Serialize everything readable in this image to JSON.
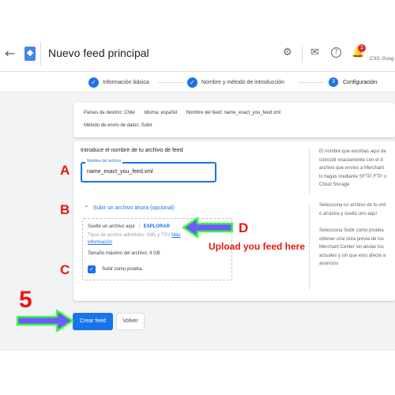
{
  "header": {
    "back_icon": "arrow-back-icon",
    "logo_icon": "merchant-center-logo-icon",
    "title": "Nuevo feed principal",
    "icons": [
      "gear-icon",
      "mail-icon",
      "help-icon",
      "bell-icon"
    ],
    "notification_count": "1",
    "account": "CSS: Goog"
  },
  "stepper": {
    "steps": [
      {
        "label": "Información básica",
        "state": "done"
      },
      {
        "label": "Nombre y método de introducción",
        "state": "done"
      },
      {
        "label": "Configuración",
        "state": "current",
        "number": "3"
      }
    ]
  },
  "summary": {
    "countries_label": "Países de destino:",
    "countries_value": "Chile",
    "language_label": "Idioma:",
    "language_value": "español",
    "file_label": "Nombre del feed:",
    "file_value": "name_exact_you_feed.xml",
    "method_label": "Método de envío de datos:",
    "method_value": "Subir"
  },
  "form": {
    "heading": "Introduce el nombre de tu archivo de feed",
    "field_label": "Nombre del archivo",
    "field_value": "name_exact_you_feed.xml",
    "help_text": [
      "El nombre que escribas aquí de",
      "coincidir exactamente con el d",
      "archivo que envíes a Merchant",
      "lo hagas mediante SFTP, FTP o",
      "Cloud Storage"
    ],
    "upload_toggle": "Subir un archivo ahora (opcional)",
    "drop_text": "Suelte un archivo aquí",
    "divider": "|",
    "explore_link": "EXPLORAR",
    "file_types": "Tipos de archivo admitidos: XML y TSV",
    "more_info_1": "Más",
    "more_info_2": "información",
    "max_size": "Tamaño máximo del archivo: 4 GB",
    "test_upload_label": "Subir como prueba",
    "test_upload_checked": true,
    "upload_help_1": [
      "Selecciona un archivo de tu ord",
      "o arrastra y suelta uno aquí"
    ],
    "upload_help_2": [
      "Selecciona Subir como prueba",
      "obtener una vista previa de tus",
      "Merchant Center sin anular los",
      "actuales y sin que esto afecte a",
      "anuncios"
    ]
  },
  "actions": {
    "create_label": "Crear feed",
    "back_label": "Volver"
  },
  "annotations": {
    "a": "A",
    "b": "B",
    "c": "C",
    "d": "D",
    "step": "5",
    "upload_note": "Upload you feed here",
    "color": "#e8160c",
    "arrow_color": "#6a5cff",
    "arrow_glow": "#3cff3c"
  },
  "colors": {
    "accent": "#1a73e8",
    "page_bg": "#f1f3f4"
  }
}
